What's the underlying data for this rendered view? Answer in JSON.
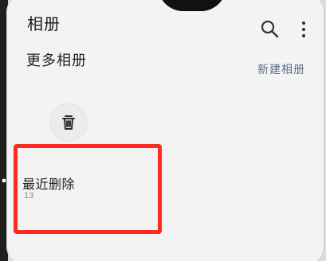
{
  "header": {
    "title": "相册",
    "search_icon": "search-icon",
    "more_icon": "more-vertical-icon"
  },
  "sections": {
    "more_albums": {
      "title": "更多相册",
      "new_album_label": "新建相册"
    }
  },
  "albums": [
    {
      "icon": "trash-icon",
      "name": "最近删除",
      "count": "13"
    }
  ],
  "colors": {
    "highlight": "#ff2a22",
    "link": "#5a6c86",
    "background": "#f3f3f3"
  }
}
